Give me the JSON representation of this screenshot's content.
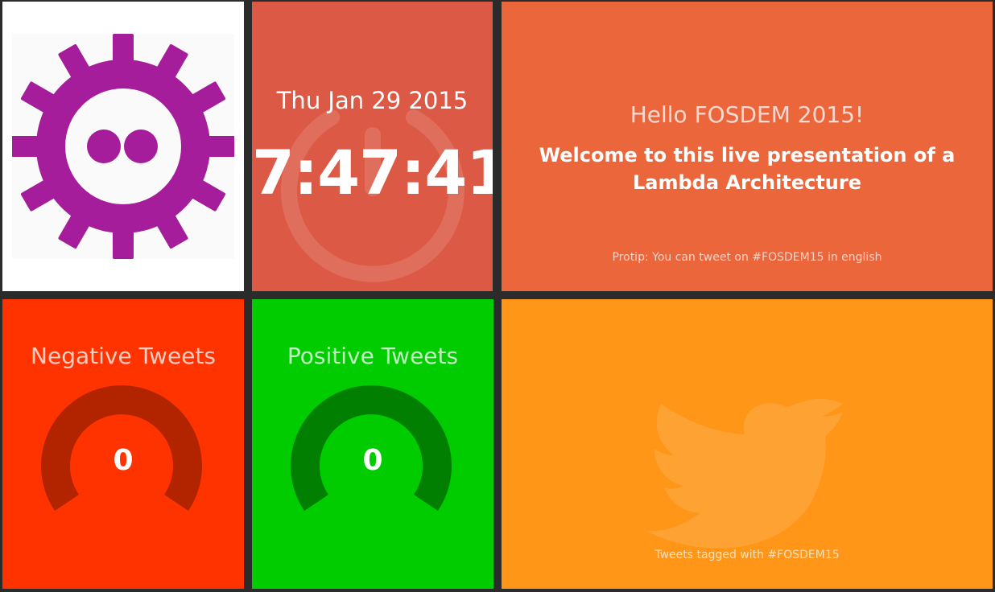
{
  "logo": {
    "icon": "fosdem-gear-logo-icon",
    "color": "#a51d9a"
  },
  "clock": {
    "date": "Thu Jan 29 2015",
    "time": "7:47:41",
    "icon": "power-icon",
    "color": "#dc5945"
  },
  "welcome": {
    "title": "Hello FOSDEM 2015!",
    "text": "Welcome to this live presentation of a Lambda Architecture",
    "more_info": "Protip: You can tweet on #FOSDEM15 in english",
    "color": "#ec663c"
  },
  "negative": {
    "title": "Negative Tweets",
    "value": "0",
    "color": "#ff3300",
    "arc_color": "#b22400"
  },
  "positive": {
    "title": "Positive Tweets",
    "value": "0",
    "color": "#00cc00",
    "arc_color": "#007f00"
  },
  "tweets": {
    "more_info": "Tweets tagged with #FOSDEM15",
    "icon": "twitter-bird-icon",
    "color": "#ff9618"
  }
}
